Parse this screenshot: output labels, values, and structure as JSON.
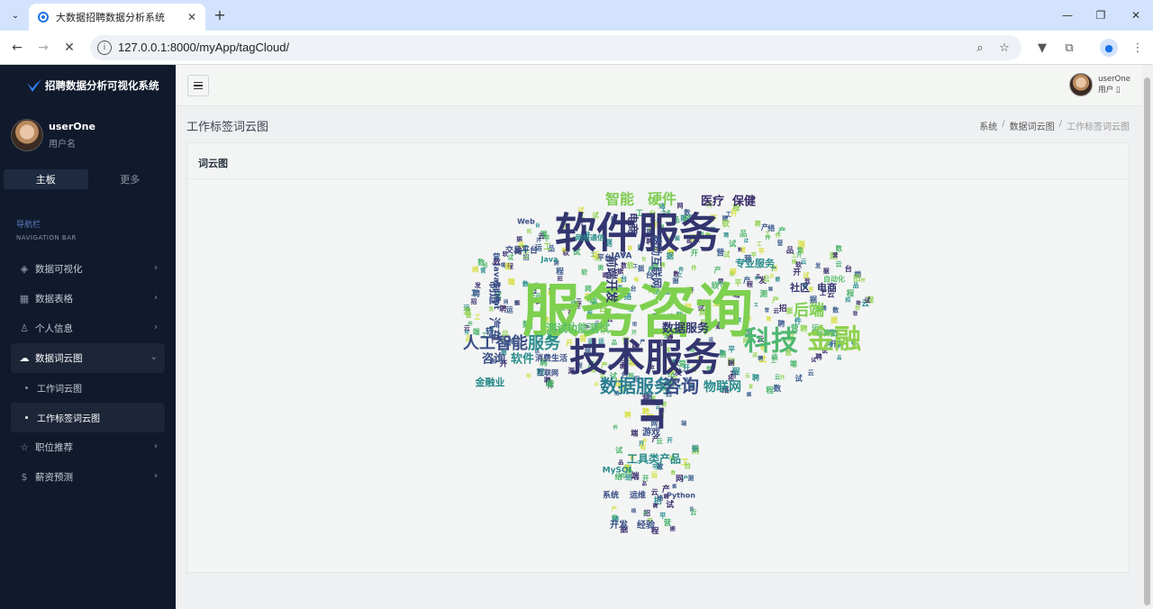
{
  "browser": {
    "tab_title": "大数据招聘数据分析系统",
    "url": "127.0.0.1:8000/myApp/tagCloud/",
    "accent_color": "#1a73e8"
  },
  "sidebar": {
    "brand": "招聘数据分析可视化系统",
    "user": {
      "name": "userOne",
      "role": "用户名"
    },
    "tabs": [
      {
        "label": "主板",
        "active": true
      },
      {
        "label": "更多",
        "active": false
      }
    ],
    "nav_header_cn": "导航栏",
    "nav_header_en": "NAVIGATION BAR",
    "menu": [
      {
        "label": "数据可视化",
        "icon": "layers-icon"
      },
      {
        "label": "数据表格",
        "icon": "grid-icon"
      },
      {
        "label": "个人信息",
        "icon": "user-icon"
      },
      {
        "label": "数据词云图",
        "icon": "cloud-icon",
        "open": true,
        "children": [
          {
            "label": "工作词云图",
            "active": false
          },
          {
            "label": "工作标签词云图",
            "active": true
          }
        ]
      },
      {
        "label": "职位推荐",
        "icon": "star-icon"
      },
      {
        "label": "薪资预测",
        "icon": "dollar-icon"
      }
    ],
    "background_color": "#111a2c"
  },
  "topbar": {
    "user_name": "userOne",
    "user_role": "用户 ▯"
  },
  "page": {
    "title": "工作标签词云图",
    "breadcrumb": [
      "系统",
      "数据词云图",
      "工作标签词云图"
    ]
  },
  "card": {
    "title": "词云图"
  },
  "wordcloud": {
    "palette": [
      "#3b2b6b",
      "#38598b",
      "#2a8c8c",
      "#4cb46b",
      "#8fd14f",
      "#d6de3a"
    ],
    "words": [
      {
        "text": "服务咨询",
        "color": "#7ed04f"
      },
      {
        "text": "软件服务",
        "color": "#33356f"
      },
      {
        "text": "技术服务",
        "color": "#33356f"
      },
      {
        "text": "科技",
        "color": "#4fb871"
      },
      {
        "text": "金融",
        "color": "#8fd14f"
      },
      {
        "text": "人工智能",
        "color": "#3a4d86"
      },
      {
        "text": "服务",
        "color": "#2a8c8c"
      },
      {
        "text": "数据服务",
        "color": "#2a7f90"
      },
      {
        "text": "咨询",
        "color": "#3a4d86"
      },
      {
        "text": "物联网",
        "color": "#2a8c8c"
      },
      {
        "text": "智能",
        "color": "#7fcc55"
      },
      {
        "text": "硬件",
        "color": "#7fcc55"
      },
      {
        "text": "医疗",
        "color": "#3b2b6b"
      },
      {
        "text": "保健",
        "color": "#3b2b6b"
      },
      {
        "text": "后端",
        "color": "#7ed04f"
      },
      {
        "text": "咨询",
        "color": "#3a4d86"
      },
      {
        "text": "软件",
        "color": "#2a8c8c"
      },
      {
        "text": "测试",
        "color": "#5bbf6a"
      },
      {
        "text": "功能测试",
        "color": "#5bbf6a"
      },
      {
        "text": "数据服务",
        "color": "#33356f"
      },
      {
        "text": "专业服务",
        "color": "#2a8c8c"
      },
      {
        "text": "社区",
        "color": "#33356f"
      },
      {
        "text": "电商",
        "color": "#33356f"
      },
      {
        "text": "汽车",
        "color": "#3a4d86"
      },
      {
        "text": "制造",
        "color": "#3a4d86"
      },
      {
        "text": "金融业",
        "color": "#2a8c8c"
      },
      {
        "text": "前端开发",
        "color": "#33356f"
      },
      {
        "text": "移动互联网",
        "color": "#3a4d86"
      },
      {
        "text": "电商",
        "color": "#33356f"
      },
      {
        "text": "IT",
        "color": "#33356f"
      },
      {
        "text": "工具类产品",
        "color": "#2a8c8c"
      },
      {
        "text": "游戏",
        "color": "#3a4d86"
      },
      {
        "text": "开发",
        "color": "#3a4d86"
      },
      {
        "text": "经验",
        "color": "#3a4d86"
      },
      {
        "text": "MySQL",
        "color": "#2a8c8c"
      },
      {
        "text": "Python",
        "color": "#3a4d86"
      },
      {
        "text": "JAVA",
        "color": "#3a4d86"
      },
      {
        "text": "Java",
        "color": "#2a8c8c"
      },
      {
        "text": "Web",
        "color": "#3a4d86"
      },
      {
        "text": "JavaScript",
        "color": "#3a4d86"
      },
      {
        "text": "网络通信",
        "color": "#2a8c8c"
      },
      {
        "text": "交易平台",
        "color": "#3a4d86"
      },
      {
        "text": "互联网",
        "color": "#3a4d86"
      },
      {
        "text": "消费生活",
        "color": "#3a4d86"
      },
      {
        "text": "计算机",
        "color": "#5bbf6a"
      },
      {
        "text": "自动化",
        "color": "#5bbf6a"
      },
      {
        "text": "平台",
        "color": "#3a4d86"
      },
      {
        "text": "系统",
        "color": "#3a4d86"
      },
      {
        "text": "运维",
        "color": "#3a4d86"
      }
    ]
  }
}
